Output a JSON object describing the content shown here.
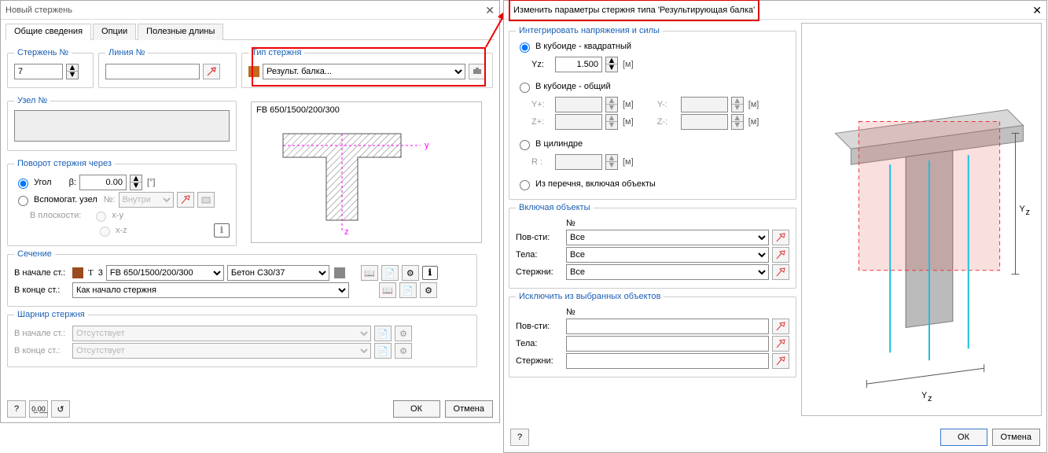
{
  "left": {
    "title": "Новый стержень",
    "tabs": [
      "Общие сведения",
      "Опции",
      "Полезные длины"
    ],
    "member_no_label": "Стержень №",
    "member_no": "7",
    "line_no_label": "Линия №",
    "line_no": "",
    "member_type_label": "Тип стержня",
    "member_type": "Результ. балка...",
    "node_no_label": "Узел №",
    "node_no": "",
    "preview_label": "FB 650/1500/200/300",
    "rotation_label": "Поворот стержня через",
    "rot_angle_label": "Угол",
    "rot_beta_symbol": "β:",
    "rot_beta": "0.00",
    "rot_unit": "[°]",
    "rot_aux_label": "Вспомогат. узел",
    "rot_aux_select": "Внутри",
    "rot_plane_label": "В плоскости:",
    "rot_plane_xy": "x-y",
    "rot_plane_xz": "x-z",
    "section_label": "Сечение",
    "sec_start_label": "В начале ст.:",
    "sec_start_code": "3",
    "sec_start_name": "FB 650/1500/200/300",
    "sec_start_mat": "Бетон C30/37",
    "sec_end_label": "В конце ст.:",
    "sec_end_value": "Как начало стержня",
    "hinge_label": "Шарнир стержня",
    "hinge_start_label": "В начале ст.:",
    "hinge_start": "Отсутствует",
    "hinge_end_label": "В конце ст.:",
    "hinge_end": "Отсутствует",
    "ok": "ОК",
    "cancel": "Отмена"
  },
  "right": {
    "title": "Изменить параметры стержня типа 'Результирующая балка'",
    "g1_label": "Интегрировать напряжения и силы",
    "opt_cuboid_sq": "В кубоиде - квадратный",
    "yz_label": "Yz:",
    "yz_val": "1.500",
    "m_unit": "[м]",
    "opt_cuboid_gen": "В кубоиде - общий",
    "yp": "Y+:",
    "ym": "Y-:",
    "zp": "Z+:",
    "zm": "Z-:",
    "opt_cyl": "В цилиндре",
    "r_label": "R :",
    "opt_cross": "Из перечня, включая объекты",
    "g2_label": "Включая объекты",
    "col_no": "№",
    "row_surf": "Пов-сти:",
    "row_tela": "Тела:",
    "row_members": "Стержни:",
    "all": "Все",
    "g3_label": "Исключить из выбранных объектов",
    "ok": "ОК",
    "cancel": "Отмена"
  }
}
